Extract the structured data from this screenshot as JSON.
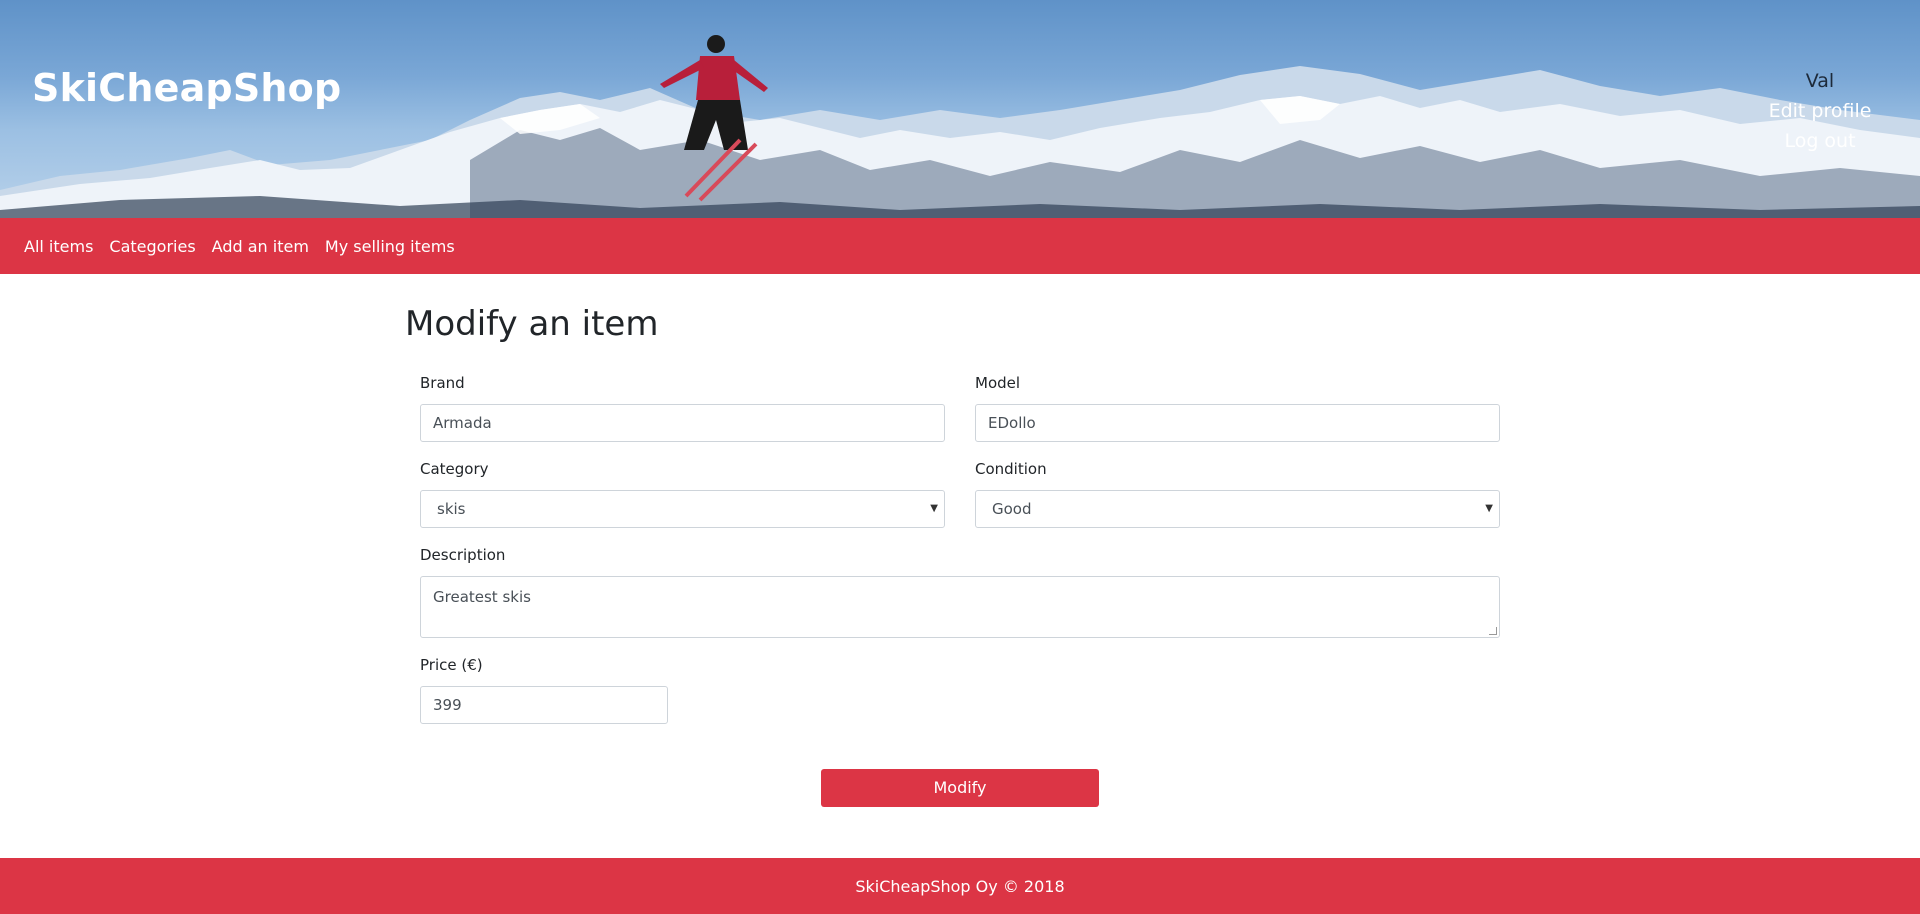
{
  "header": {
    "brand": "SkiCheapShop",
    "user_name": "Val",
    "edit_profile": "Edit profile",
    "log_out": "Log out"
  },
  "nav": {
    "items": [
      {
        "label": "All items"
      },
      {
        "label": "Categories"
      },
      {
        "label": "Add an item"
      },
      {
        "label": "My selling items"
      }
    ]
  },
  "form": {
    "title": "Modify an item",
    "brand_label": "Brand",
    "brand_value": "Armada",
    "model_label": "Model",
    "model_value": "EDollo",
    "category_label": "Category",
    "category_value": "skis",
    "condition_label": "Condition",
    "condition_value": "Good",
    "description_label": "Description",
    "description_value": "Greatest skis",
    "price_label": "Price (€)",
    "price_value": "399",
    "submit_label": "Modify"
  },
  "footer": {
    "text": "SkiCheapShop Oy © 2018"
  },
  "colors": {
    "accent": "#dc3545",
    "sky": "#7aa7d6"
  }
}
